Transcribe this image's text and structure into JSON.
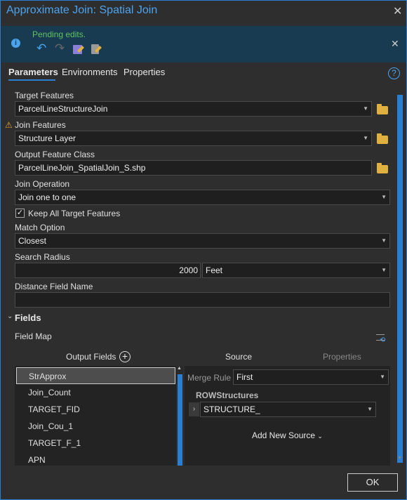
{
  "window": {
    "title": "Approximate Join: Spatial Join"
  },
  "info_bar": {
    "message": "Pending edits.",
    "icons": [
      "info-icon",
      "undo-icon",
      "redo-icon",
      "save-edits-icon",
      "discard-edits-icon"
    ]
  },
  "tabs": [
    {
      "label": "Parameters",
      "active": true
    },
    {
      "label": "Environments"
    },
    {
      "label": "Properties"
    }
  ],
  "params": {
    "target_features": {
      "label": "Target Features",
      "value": "ParcelLineStructureJoin"
    },
    "join_features": {
      "label": "Join Features",
      "value": "Structure Layer",
      "warning": true
    },
    "output_feature_class": {
      "label": "Output Feature Class",
      "value": "ParcelLineJoin_SpatialJoin_S.shp"
    },
    "join_operation": {
      "label": "Join Operation",
      "value": "Join one to one"
    },
    "keep_all": {
      "label": "Keep All Target Features",
      "checked": true
    },
    "match_option": {
      "label": "Match Option",
      "value": "Closest"
    },
    "search_radius": {
      "label": "Search Radius",
      "value": "2000",
      "unit": "Feet"
    },
    "distance_field": {
      "label": "Distance Field Name",
      "value": ""
    }
  },
  "fields": {
    "header": "Fields",
    "field_map_label": "Field Map",
    "output_fields_label": "Output Fields",
    "source_tab": "Source",
    "properties_tab": "Properties",
    "output_fields": [
      "StrApprox",
      "Join_Count",
      "TARGET_FID",
      "Join_Cou_1",
      "TARGET_F_1",
      "APN"
    ],
    "selected": "StrApprox",
    "merge_rule_label": "Merge Rule",
    "merge_rule": "First",
    "source_group": "ROWStructures",
    "source_field": "STRUCTURE_",
    "add_new_source": "Add New Source"
  },
  "footer": {
    "ok": "OK"
  },
  "colors": {
    "accent": "#2c7fd0",
    "title": "#4ba3ee",
    "pending": "#5fc35f",
    "warning": "#e8a33a"
  }
}
